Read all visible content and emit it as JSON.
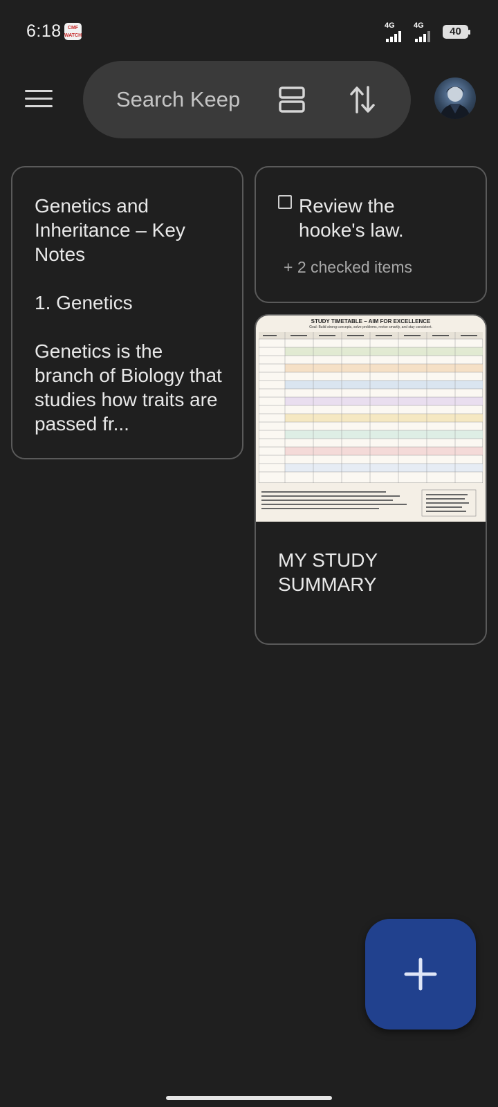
{
  "status_bar": {
    "time": "6:18",
    "notification_badge": "CMF WATCH",
    "signal_1_label": "4G",
    "signal_2_label": "4G",
    "battery": "40"
  },
  "top_bar": {
    "menu_icon": "hamburger-menu-icon",
    "search_placeholder": "Search Keep",
    "view_toggle_icon": "list-view-icon",
    "sort_icon": "sort-arrows-icon",
    "avatar_icon": "user-avatar"
  },
  "notes": [
    {
      "type": "text",
      "text": "Genetics and Inheritance – Key Notes\n\n1. Genetics\n\nGenetics is the branch of Biology that studies how traits are passed fr..."
    },
    {
      "type": "checklist",
      "unchecked_item": "Review the hooke's law.",
      "checked_count": "+ 2 checked items"
    },
    {
      "type": "image",
      "image_title": "STUDY TIMETABLE – AIM FOR EXCELLENCE",
      "image_goal": "Goal: Build strong concepts, solve problems, revise smartly, and stay consistent.",
      "image_goals_header": "GOALS FOR EACH SUBJECT",
      "image_tips_header": "TIPS",
      "title": "MY STUDY SUMMARY"
    }
  ],
  "fab": {
    "icon": "plus-icon",
    "label": "+"
  },
  "colors": {
    "background": "#1f1f1f",
    "search_bg": "#3a3a3a",
    "card_border": "#5a5a5a",
    "fab": "#21418e"
  }
}
